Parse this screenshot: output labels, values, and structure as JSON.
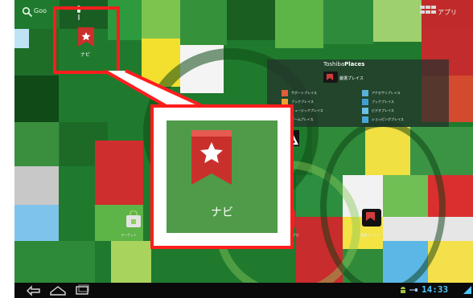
{
  "search": {
    "label": "Goo"
  },
  "apps": {
    "label": "アプリ"
  },
  "navi_app": {
    "label": "ナビ"
  },
  "callout": {
    "label": "ナビ"
  },
  "places_widget": {
    "title_prefix": "Toshiba",
    "title_suffix": "Places",
    "featured_label": "厳選プレイス",
    "left_items": [
      "サポートプレイス",
      "ブックプレイス",
      "ミュージックプレイス",
      "ゲームプレイス"
    ],
    "right_items": [
      "アクセサリプレイス",
      "ブックプレイス",
      "ビデオプレイス",
      "ショッピングプレイス"
    ]
  },
  "home_icons": [
    {
      "label": "マーケット"
    },
    {
      "label": "ナビ"
    },
    {
      "label": "厳選プレイス"
    }
  ],
  "status": {
    "time": "14:33"
  },
  "colors": {
    "highlight": "#ff1d1d",
    "clock": "#4fc7ff",
    "navi_red": "#c9302c"
  },
  "icons": [
    "search-icon",
    "mic-icon",
    "apps-grid-icon",
    "back-icon",
    "home-icon",
    "recent-apps-icon",
    "android-icon",
    "usb-icon",
    "wifi-icon"
  ]
}
